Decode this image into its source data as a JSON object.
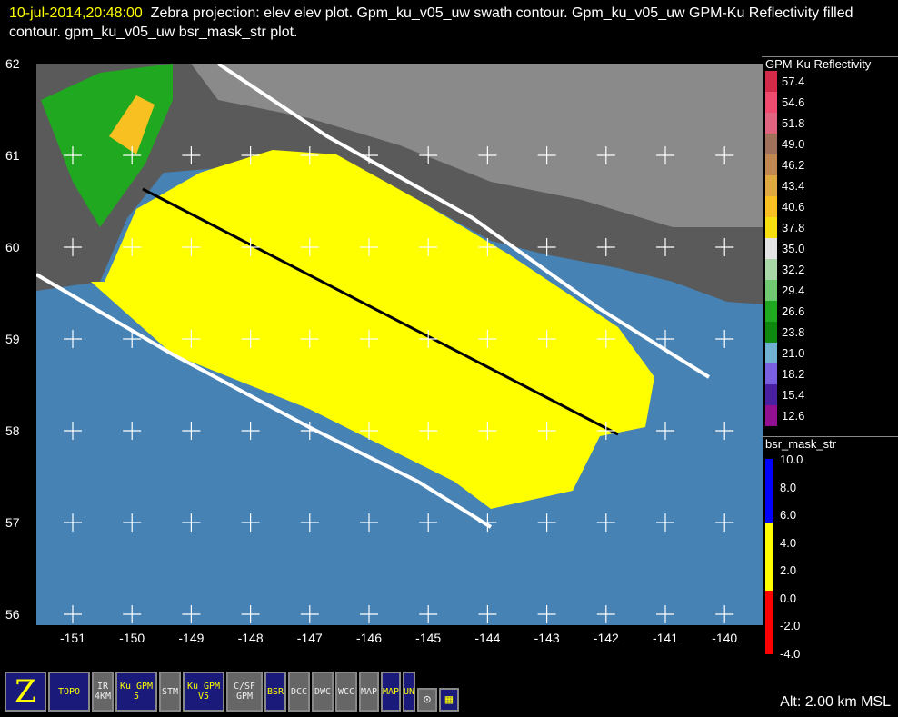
{
  "title": {
    "time": "10-jul-2014,20:48:00",
    "text": "Zebra projection: elev elev  plot.  Gpm_ku_v05_uw swath contour.  Gpm_ku_v05_uw GPM-Ku Reflectivity filled contour.  gpm_ku_v05_uw bsr_mask_str  plot."
  },
  "map": {
    "lat_labels": [
      "62",
      "61",
      "60",
      "59",
      "58",
      "57",
      "56"
    ],
    "lon_labels": [
      "-151",
      "-150",
      "-149",
      "-148",
      "-147",
      "-146",
      "-145",
      "-144",
      "-143",
      "-142",
      "-141",
      "-140"
    ],
    "colors": {
      "ocean": "#4682b4",
      "swath_fill": "#ffff00",
      "land": "#5a5a5a",
      "swath_edge": "#ffffff"
    }
  },
  "legend1": {
    "title": "GPM-Ku Reflectivity",
    "items": [
      {
        "label": "57.4",
        "color": "#d42a4a"
      },
      {
        "label": "54.6",
        "color": "#f04a70"
      },
      {
        "label": "51.8",
        "color": "#e06480"
      },
      {
        "label": "49.0",
        "color": "#a0705a"
      },
      {
        "label": "46.2",
        "color": "#c08850"
      },
      {
        "label": "43.4",
        "color": "#e0a840"
      },
      {
        "label": "40.6",
        "color": "#f8c020"
      },
      {
        "label": "37.8",
        "color": "#f8e010"
      },
      {
        "label": "35.0",
        "color": "#e4e4e4"
      },
      {
        "label": "32.2",
        "color": "#a8d8a8"
      },
      {
        "label": "29.4",
        "color": "#70c870"
      },
      {
        "label": "26.6",
        "color": "#20a820"
      },
      {
        "label": "23.8",
        "color": "#108810"
      },
      {
        "label": "21.0",
        "color": "#70b0d0"
      },
      {
        "label": "18.2",
        "color": "#7860e0"
      },
      {
        "label": "15.4",
        "color": "#4820a0"
      },
      {
        "label": "12.6",
        "color": "#901090"
      }
    ]
  },
  "legend2": {
    "title": "bsr_mask_str",
    "labels": [
      "10.0",
      "8.0",
      "6.0",
      "4.0",
      "2.0",
      "0.0",
      "-2.0",
      "-4.0"
    ],
    "colors": [
      "#0000ff",
      "#ffff00",
      "#ff0000"
    ]
  },
  "toolbar": [
    "Z",
    "TOPO",
    "IR 4KM",
    "Ku GPM 5",
    "STM",
    "Ku GPM V5",
    "C/SF GPM",
    "BSR",
    "DCC",
    "DWC",
    "WCC",
    "MAP",
    "MAP",
    "BOUNDS",
    "⊙",
    "▦"
  ],
  "status": {
    "alt": "Alt: 2.00 km MSL"
  }
}
